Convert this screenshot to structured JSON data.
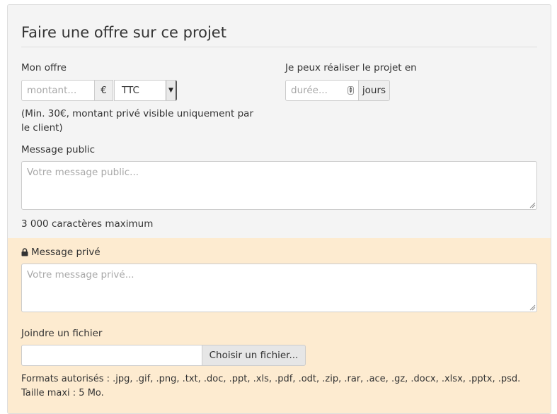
{
  "form": {
    "title": "Faire une offre sur ce projet",
    "offer": {
      "label": "Mon offre",
      "amount_placeholder": "montant...",
      "currency": "€",
      "tax_selected": "TTC",
      "hint": "(Min. 30€, montant privé visible uniquement par le client)"
    },
    "duration": {
      "label": "Je peux réaliser le projet en",
      "placeholder": "durée...",
      "unit": "jours"
    },
    "public_message": {
      "label": "Message public",
      "placeholder": "Votre message public...",
      "limit_note": "3 000 caractères maximum"
    },
    "private_message": {
      "label": "Message privé",
      "icon": "lock-icon",
      "placeholder": "Votre message privé..."
    },
    "attachment": {
      "label": "Joindre un fichier",
      "button_label": "Choisir un fichier...",
      "formats_note": "Formats autorisés : .jpg, .gif, .png, .txt, .doc, .ppt, .xls, .pdf, .odt, .zip, .rar, .ace, .gz, .docx, .xlsx, .pptx, .psd.",
      "max_size_note": "Taille maxi : 5 Mo."
    }
  },
  "colors": {
    "panel_bg": "#f4f4f4",
    "private_bg": "#fdebd0",
    "border": "#cccccc"
  }
}
